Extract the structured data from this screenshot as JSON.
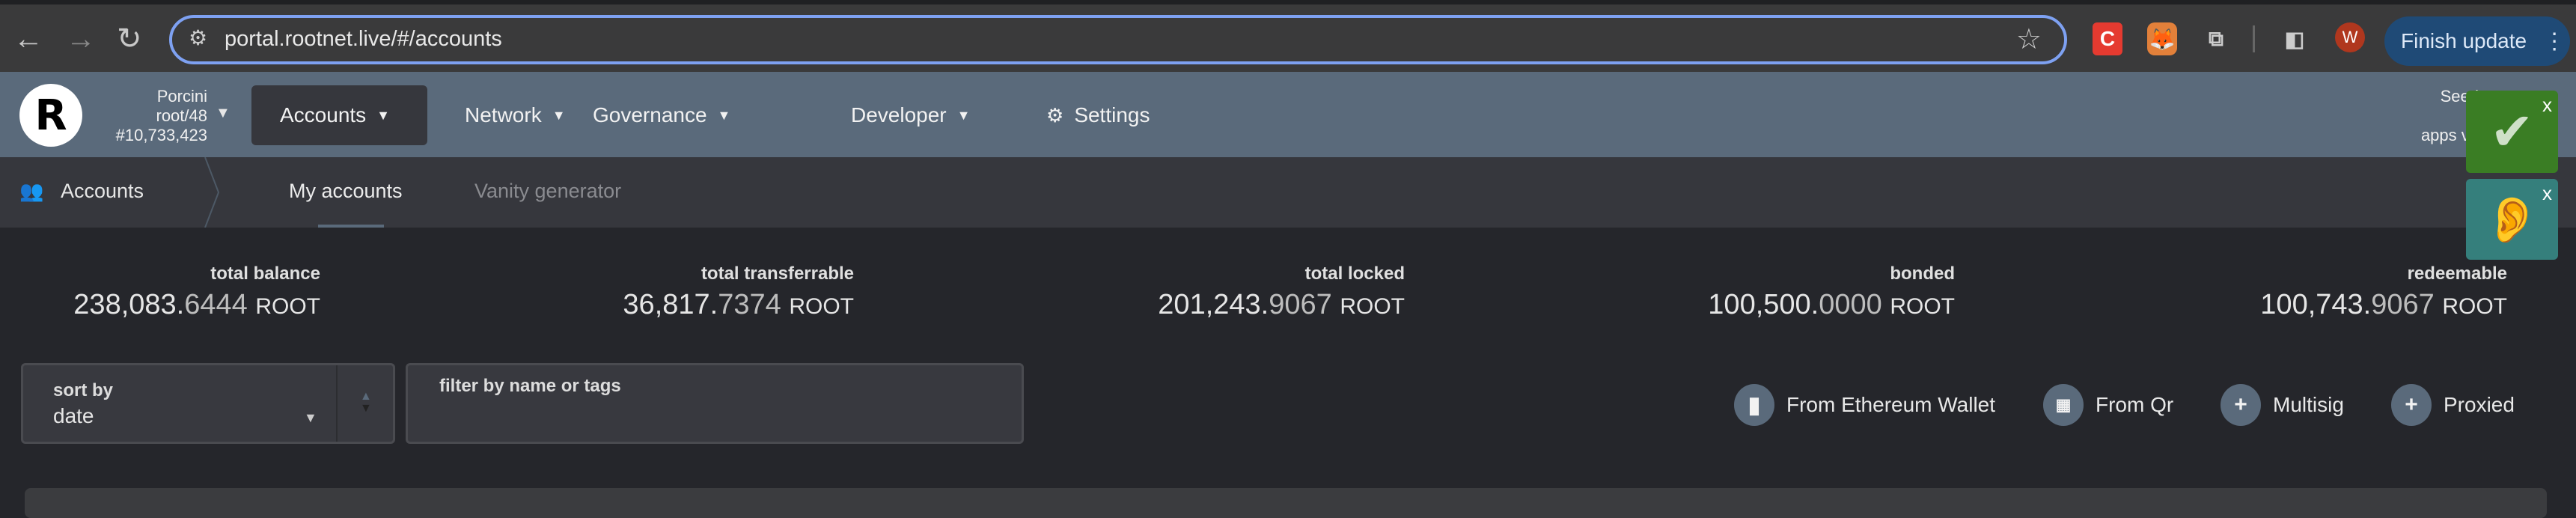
{
  "browser": {
    "url": "portal.rootnet.live/#/accounts",
    "finish_update": "Finish update",
    "avatar_letter": "W"
  },
  "header": {
    "chain_name": "Porcini",
    "runtime": "root/48",
    "block": "#10,733,423",
    "menu": [
      {
        "label": "Accounts"
      },
      {
        "label": "Network"
      },
      {
        "label": "Governance"
      },
      {
        "label": "Developer"
      },
      {
        "label": "Settings"
      }
    ],
    "right_info": [
      "Seed",
      "a",
      "apps v0"
    ]
  },
  "subnav": {
    "section": "Accounts",
    "tabs": [
      {
        "label": "My accounts",
        "active": true
      },
      {
        "label": "Vanity generator",
        "active": false
      }
    ]
  },
  "summary": [
    {
      "label": "total balance",
      "int": "238,083.",
      "dec": "6444",
      "unit": "ROOT"
    },
    {
      "label": "total transferrable",
      "int": "36,817.",
      "dec": "7374",
      "unit": "ROOT"
    },
    {
      "label": "total locked",
      "int": "201,243.",
      "dec": "9067",
      "unit": "ROOT"
    },
    {
      "label": "bonded",
      "int": "100,500.",
      "dec": "0000",
      "unit": "ROOT"
    },
    {
      "label": "redeemable",
      "int": "100,743.",
      "dec": "9067",
      "unit": "ROOT"
    }
  ],
  "controls": {
    "sort_label": "sort by",
    "sort_value": "date",
    "filter_label": "filter by name or tags"
  },
  "actions": [
    {
      "label": "From Ethereum Wallet",
      "icon": "wallet-icon"
    },
    {
      "label": "From Qr",
      "icon": "qr-icon"
    },
    {
      "label": "Multisig",
      "icon": "plus-icon"
    },
    {
      "label": "Proxied",
      "icon": "plus-icon"
    }
  ],
  "colors": {
    "header": "#5a6a7b",
    "background": "#25262b",
    "accent": "#7ea1f2",
    "overlay_green": "#3a7d24",
    "overlay_teal": "#357f7c"
  }
}
